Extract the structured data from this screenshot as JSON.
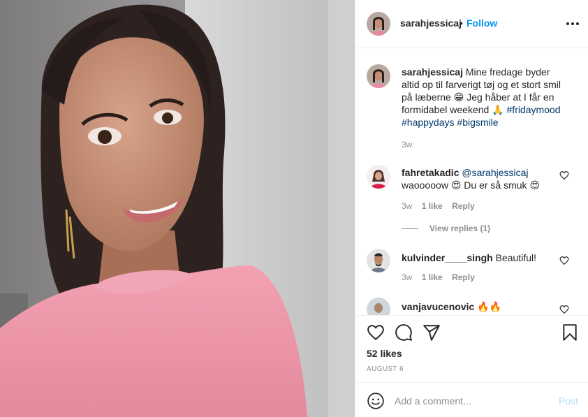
{
  "post": {
    "image_alt": "selfie-photo"
  },
  "header": {
    "username": "sarahjessicaj",
    "separator": "•",
    "follow_label": "Follow",
    "more_icon": "more-horizontal-icon"
  },
  "caption": {
    "username": "sarahjessicaj",
    "text_part1": "Mine fredage byder altid op til farverigt tøj og et stort smil på læberne 😁 Jeg håber at I får en formidabel weekend 🙏 ",
    "hashtags": [
      "#fridaymood",
      "#happydays",
      "#bigsmile"
    ],
    "time": "3w"
  },
  "comments": [
    {
      "username": "fahretakadic",
      "mention": "@sarahjessicaj",
      "text": "waooooow 😍 Du er så smuk 😍",
      "time": "3w",
      "likes": "1 like",
      "reply_label": "Reply",
      "view_replies": "View replies (1)"
    },
    {
      "username": "kulvinder____singh",
      "text": "Beautiful!",
      "time": "3w",
      "likes": "1 like",
      "reply_label": "Reply"
    },
    {
      "username": "vanjavucenovic",
      "text": "🔥🔥"
    }
  ],
  "actions": {
    "likes": "52 likes",
    "date": "AUGUST 6",
    "icons": [
      "heart-icon",
      "comment-icon",
      "share-icon",
      "bookmark-icon"
    ]
  },
  "composer": {
    "placeholder": "Add a comment...",
    "post_label": "Post"
  },
  "colors": {
    "accent": "#0095f6",
    "hashtag": "#00376b",
    "muted": "#8e8e8e",
    "post_disabled": "#b2dffc"
  }
}
